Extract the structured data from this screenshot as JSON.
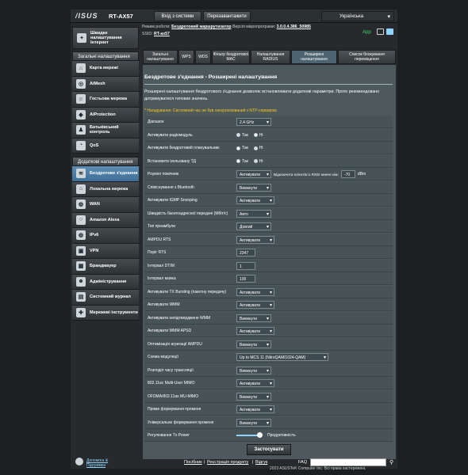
{
  "header": {
    "logo": "/ISUS",
    "model": "RT-AX57",
    "logout": "Вхід з системи",
    "reboot": "Перезавантажити",
    "language": "Українська"
  },
  "info": {
    "mode_label": "Режим роботи:",
    "mode_value": "Бездротовий маршрутизатор",
    "fw_label": "Версія мікропрограми:",
    "fw_value": "3.0.0.4.386_50985",
    "ssid_label": "SSID:",
    "ssid_value": "RT-ax57",
    "app": "App"
  },
  "sidebar": {
    "quick": "Швидке налаштування Інтернет",
    "general_header": "Загальні налаштування",
    "general": [
      "Карта мережі",
      "AiMesh",
      "Гостьова мережа",
      "AiProtection",
      "Батьківський контроль",
      "QoS"
    ],
    "advanced_header": "Додаткові налаштування",
    "advanced": [
      "Бездротове з'єднання",
      "Локальна мережа",
      "WAN",
      "Amazon Alexa",
      "IPv6",
      "VPN",
      "Брандмауер",
      "Адміністрування",
      "Системний журнал",
      "Мережеві інструменти"
    ]
  },
  "tabs": [
    "Загальні налаштування",
    "WPS",
    "WDS",
    "Фільтр бездротової MAC",
    "Налаштування RADIUS",
    "Розширені налаштування",
    "Список блокування переміщення"
  ],
  "page": {
    "title": "Бездротове з'єднання - Розширені налаштування",
    "description": "Розширені налаштування бездротового з'єднання дозволяє встановлювати додаткові параметри. Проте рекомендовано дотримуватися типових значень.",
    "note": "* Нагадування: Системний час не був синхронізований з NTP-сервером."
  },
  "rows": [
    {
      "label": "Діапазон",
      "type": "select",
      "value": "2.4 GHz"
    },
    {
      "label": "Активувати радіомодуль",
      "type": "radio",
      "opts": [
        "Так",
        "Ні"
      ],
      "on": 0
    },
    {
      "label": "Активувати бездротовий планувальник",
      "type": "radio",
      "opts": [
        "Так",
        "Ні"
      ],
      "on": 1
    },
    {
      "label": "Встановити ізольовану ТД",
      "type": "radio",
      "opts": [
        "Так",
        "Ні"
      ],
      "on": 1
    },
    {
      "label": "Роумінг помічник",
      "type": "roam",
      "value": "Активувати",
      "text": "Відключити клієнтів із RSSI нижче ніж:",
      "num": "-70",
      "unit": "dBm"
    },
    {
      "label": "Співіснування з Bluetooth",
      "type": "select",
      "value": "Вимкнути"
    },
    {
      "label": "Активувати IGMP Snooping",
      "type": "select",
      "value": "Активувати"
    },
    {
      "label": "Швидкість багатоадресної передачі (Мбіт/с)",
      "type": "select",
      "value": "Авто"
    },
    {
      "label": "Тип преамбули",
      "type": "select",
      "value": "Довгий"
    },
    {
      "label": "AMPDU RTS",
      "type": "select",
      "value": "Активувати"
    },
    {
      "label": "Поріг RTS",
      "type": "input",
      "value": "2347"
    },
    {
      "label": "Інтервал DTIM",
      "type": "input",
      "value": "1"
    },
    {
      "label": "Інтервал маяка",
      "type": "input",
      "value": "100"
    },
    {
      "label": "Активувати TX Bursting (пакетну передачу)",
      "type": "select",
      "value": "Активувати"
    },
    {
      "label": "Активувати WMM",
      "type": "select",
      "value": "Активувати"
    },
    {
      "label": "Активувати непідтверджене WMM",
      "type": "select",
      "value": "Вимкнути"
    },
    {
      "label": "Активувати WMM APSD",
      "type": "select",
      "value": "Активувати"
    },
    {
      "label": "Оптимізація агрегації AMPDU",
      "type": "select",
      "value": "Вимкнути"
    },
    {
      "label": "Схема модуляції",
      "type": "select",
      "value": "Up to MCS 11 (NitroQAM/1024-QAM)"
    },
    {
      "label": "Розподіл часу трансляції",
      "type": "select",
      "value": "Вимкнути"
    },
    {
      "label": "802.11ac Multi-User MIMO",
      "type": "select",
      "value": "Активувати"
    },
    {
      "label": "OFDMA/802.11ax MU-MIMO",
      "type": "select",
      "value": "Вимкнути"
    },
    {
      "label": "Пряме формування променя",
      "type": "select",
      "value": "Активувати"
    },
    {
      "label": "Універсальне формування променя",
      "type": "select",
      "value": "Вимкнути"
    },
    {
      "label": "Регулювання Tx Power",
      "type": "slider",
      "value": "Продуктивність",
      "level": 1.0
    }
  ],
  "apply": "Застосувати",
  "footer": {
    "help": "Допомога & Підтримка",
    "links": [
      "Посібник",
      "Реєстрація продукту",
      "Відгук"
    ],
    "faq": "FAQ"
  },
  "copyright": "2023 ASUSTeK Computer Inc. Всі права застережені."
}
